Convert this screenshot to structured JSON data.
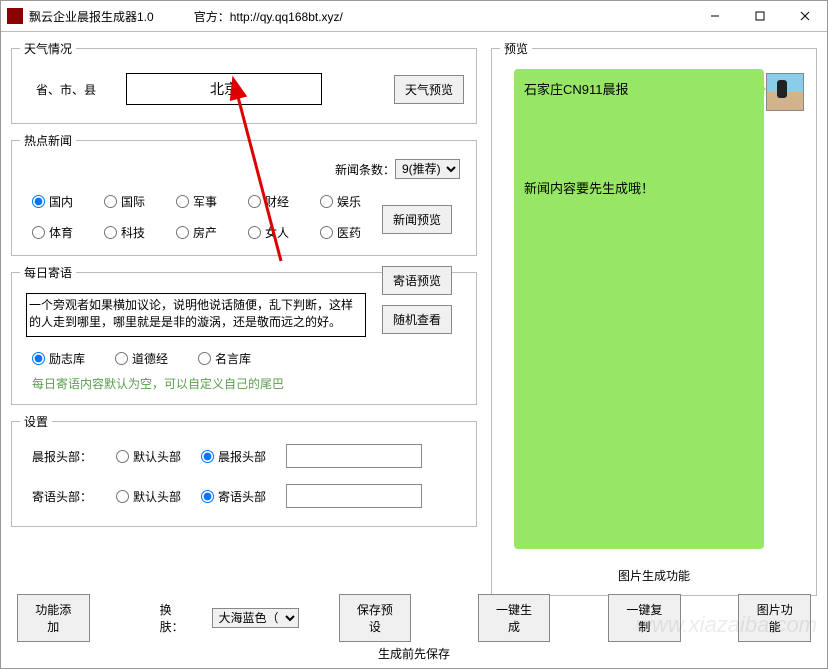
{
  "titlebar": {
    "app_title": "飘云企业晨报生成器1.0",
    "official": "官方：http://qy.qq168bt.xyz/"
  },
  "weather": {
    "legend": "天气情况",
    "label": "省、市、县",
    "city": "北京",
    "preview_btn": "天气预览"
  },
  "news": {
    "legend": "热点新闻",
    "count_label": "新闻条数：",
    "count_value": "9(推荐)",
    "categories": [
      "国内",
      "国际",
      "军事",
      "财经",
      "娱乐",
      "体育",
      "科技",
      "房产",
      "女人",
      "医药"
    ],
    "selected": "国内",
    "preview_btn": "新闻预览"
  },
  "quote": {
    "legend": "每日寄语",
    "text": "一个旁观者如果横加议论，说明他说话随便，乱下判断，这样的人走到哪里，哪里就是是非的漩涡，还是敬而远之的好。",
    "libs": [
      "励志库",
      "道德经",
      "名言库"
    ],
    "selected_lib": "励志库",
    "preview_btn": "寄语预览",
    "random_btn": "随机查看",
    "hint": "每日寄语内容默认为空，可以自定义自己的尾巴"
  },
  "settings": {
    "legend": "设置",
    "rows": [
      {
        "label": "晨报头部：",
        "opts": [
          "默认头部",
          "晨报头部"
        ],
        "sel": "晨报头部"
      },
      {
        "label": "寄语头部：",
        "opts": [
          "默认头部",
          "寄语头部"
        ],
        "sel": "寄语头部"
      }
    ]
  },
  "bottom": {
    "add_fn": "功能添加",
    "skin_label": "换肤：",
    "skin_value": "大海蓝色（",
    "save_preset": "保存预设",
    "one_gen": "一键生成",
    "one_copy": "一键复制",
    "img_fn": "图片功能",
    "footer": "生成前先保存"
  },
  "preview": {
    "legend": "预览",
    "bubble_title": "石家庄CN911晨报",
    "bubble_body": "新闻内容要先生成哦！",
    "caption": "图片生成功能"
  }
}
